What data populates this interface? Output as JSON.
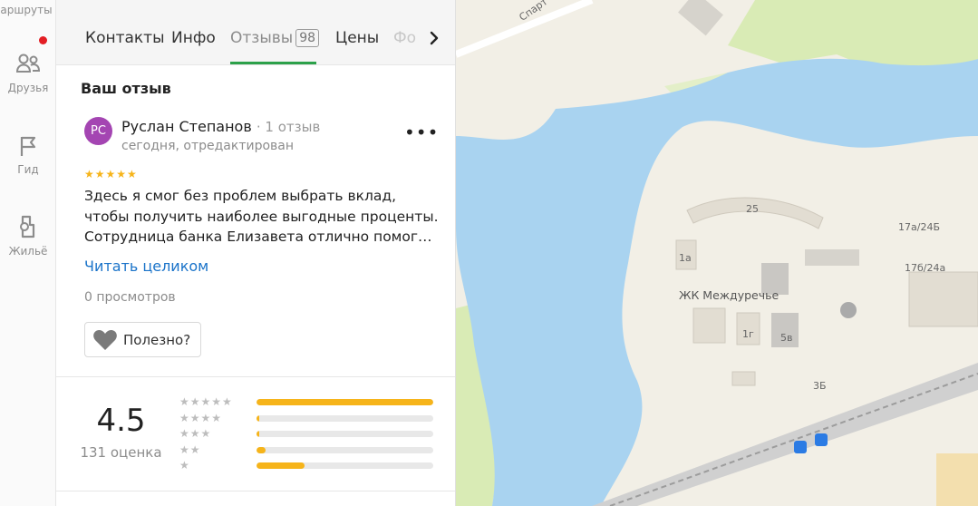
{
  "rail": {
    "routes_label": "аршруты",
    "friends_label": "Друзья",
    "guide_label": "Гид",
    "housing_label": "Жильё"
  },
  "tabs": {
    "contacts": "Контакты",
    "info": "Инфо",
    "reviews": "Отзывы",
    "reviews_count": "98",
    "prices": "Цены",
    "photo": "Фо"
  },
  "review": {
    "section_title": "Ваш отзыв",
    "avatar_initials": "РС",
    "author": "Руслан Степанов",
    "author_reviews": "· 1 отзыв",
    "date": "сегодня, отредактирован",
    "rating_stars": "★★★★★",
    "text": "Здесь я смог без проблем выбрать вклад, чтобы получить наиболее выгодные проценты. Сотрудница банка Елизавета отлично помог…",
    "read_more": "Читать целиком",
    "views": "0 просмотров",
    "useful_label": "Полезно?"
  },
  "rating": {
    "value": "4.5",
    "count_label": "131 оценка",
    "breakdown": [
      {
        "stars": "★★★★★",
        "fraction": 1.0
      },
      {
        "stars": "★★★★",
        "fraction": 0.01
      },
      {
        "stars": "★★★",
        "fraction": 0.01
      },
      {
        "stars": "★★",
        "fraction": 0.05
      },
      {
        "stars": "★",
        "fraction": 0.27
      }
    ]
  },
  "map": {
    "street": "Спарт",
    "complex": "ЖК Междуречье",
    "house_25": "25",
    "house_1a": "1а",
    "house_1g": "1г",
    "house_5v": "5в",
    "house_3b": "3Б",
    "house_17a24b": "17а/24Б",
    "house_17b24a": "17б/24а",
    "colors": {
      "water": "#a9d3f0",
      "land": "#f2efe6",
      "park": "#d9ebb5",
      "building": "#e2ddd2"
    }
  }
}
